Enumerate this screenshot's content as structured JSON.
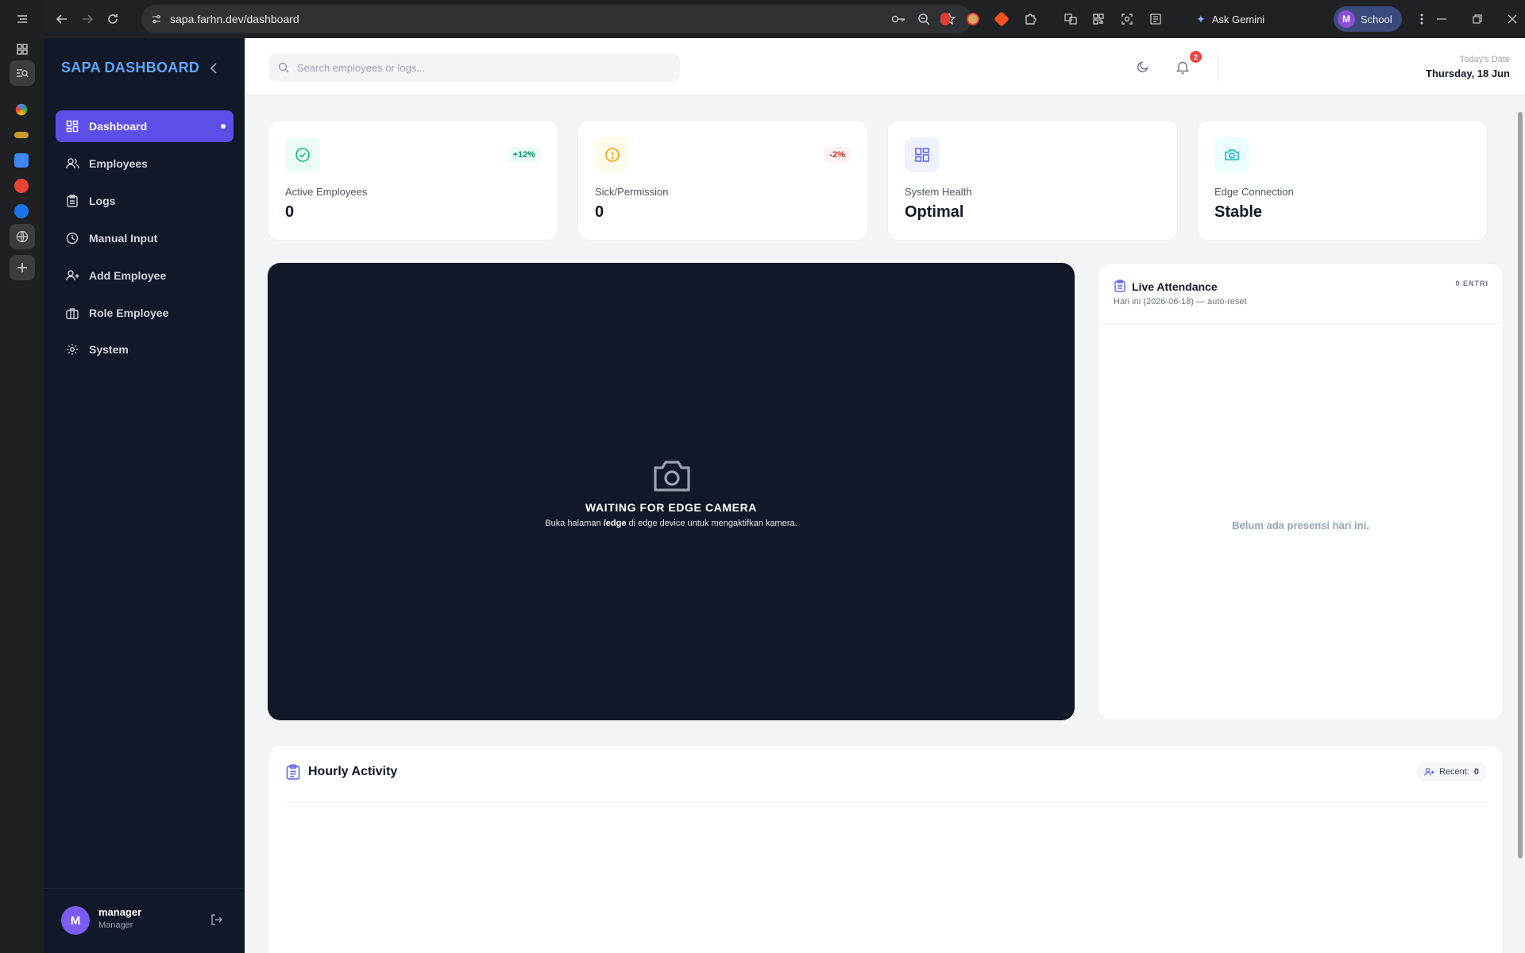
{
  "browser": {
    "url": "sapa.farhn.dev/dashboard",
    "gemini_label": "Ask Gemini",
    "profile_label": "School",
    "profile_initial": "M"
  },
  "sidebar": {
    "brand": "SAPA DASHBOARD",
    "items": [
      {
        "label": "Dashboard",
        "icon": "grid-icon",
        "active": true
      },
      {
        "label": "Employees",
        "icon": "users-icon"
      },
      {
        "label": "Logs",
        "icon": "clipboard-icon"
      },
      {
        "label": "Manual Input",
        "icon": "clock-icon"
      },
      {
        "label": "Add Employee",
        "icon": "user-plus-icon"
      },
      {
        "label": "Role Employee",
        "icon": "briefcase-icon"
      },
      {
        "label": "System",
        "icon": "gear-icon"
      }
    ],
    "user": {
      "initial": "M",
      "name": "manager",
      "role": "Manager"
    }
  },
  "header": {
    "search_placeholder": "Search employees or logs...",
    "notification_count": "2",
    "date_label": "Today's Date",
    "date_value": "Thursday, 18 Jun"
  },
  "stats": [
    {
      "label": "Active Employees",
      "value": "0",
      "delta": "+12%",
      "icon": "check-circle-icon",
      "accent": "#10b981"
    },
    {
      "label": "Sick/Permission",
      "value": "0",
      "delta": "-2%",
      "icon": "alert-circle-icon",
      "accent": "#f59e0b"
    },
    {
      "label": "System Health",
      "value": "Optimal",
      "icon": "grid-icon",
      "accent": "#6366f1"
    },
    {
      "label": "Edge Connection",
      "value": "Stable",
      "icon": "camera-icon",
      "accent": "#06b6d4"
    }
  ],
  "camera": {
    "title": "WAITING FOR EDGE CAMERA",
    "sub_before": "Buka halaman ",
    "sub_bold": "/edge",
    "sub_after": " di edge device untuk mengaktifkan kamera."
  },
  "live": {
    "title": "Live Attendance",
    "subtitle": "Hari ini (2026-06-18) — auto-reset",
    "count": "0 ENTRI",
    "empty": "Belum ada presensi hari ini."
  },
  "hourly": {
    "title": "Hourly Activity",
    "recent_label": "Recent:",
    "recent_value": "0"
  },
  "colors": {
    "sidebar_bg": "#111827",
    "active_nav": "#5b4fe8",
    "brand": "#60a5fa"
  }
}
